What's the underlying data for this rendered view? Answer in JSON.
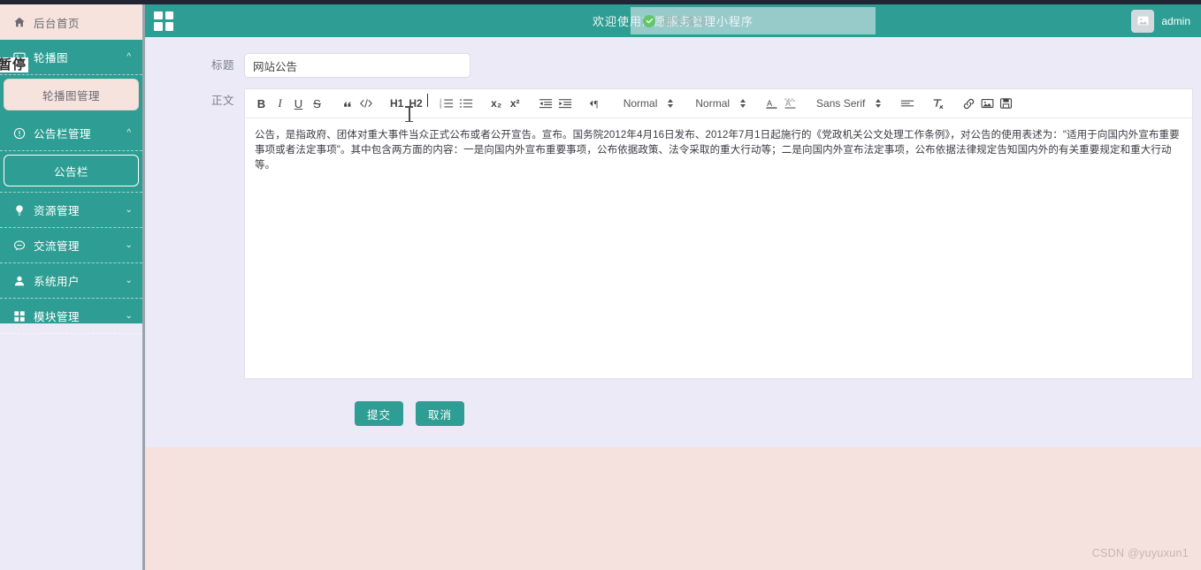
{
  "colors": {
    "brand": "#2e9e94",
    "sidebar_pink": "#f6e3de",
    "content_bg": "#ebeaf6",
    "content_bottom": "#f5e2de",
    "toast_green": "#63c66b",
    "top_strip": "#1f2533"
  },
  "header": {
    "menu_icon": "grid-menu-icon",
    "welcome_title": "欢迎使用志愿服务管理小程序",
    "toast": {
      "icon": "check-circle-icon",
      "message": "提交成功!"
    },
    "user": {
      "avatar_icon": "image-placeholder-icon",
      "name": "admin"
    }
  },
  "sidebar": {
    "home": {
      "icon": "home-icon",
      "label": "后台首页"
    },
    "groups": [
      {
        "icon": "image-icon",
        "label": "轮播图",
        "caret": "chevron-up-icon",
        "expanded": true,
        "children": [
          {
            "label": "轮播图管理",
            "active": false
          }
        ]
      },
      {
        "icon": "alert-circle-icon",
        "label": "公告栏管理",
        "caret": "chevron-up-icon",
        "expanded": true,
        "children": [
          {
            "label": "公告栏",
            "active": true
          }
        ]
      },
      {
        "icon": "bulb-icon",
        "label": "资源管理",
        "caret": "chevron-down-icon",
        "expanded": false,
        "children": []
      },
      {
        "icon": "chat-icon",
        "label": "交流管理",
        "caret": "chevron-down-icon",
        "expanded": false,
        "children": []
      },
      {
        "icon": "user-icon",
        "label": "系统用户",
        "caret": "chevron-down-icon",
        "expanded": false,
        "children": []
      },
      {
        "icon": "grid-icon",
        "label": "模块管理",
        "caret": "chevron-down-icon",
        "expanded": false,
        "children": []
      }
    ],
    "overlay_artifact": "暂停"
  },
  "form": {
    "title_field": {
      "label": "标题",
      "value": "网站公告",
      "placeholder": ""
    },
    "body_field": {
      "label": "正文"
    },
    "submit_label": "提交",
    "cancel_label": "取消"
  },
  "editor": {
    "toolbar": {
      "bold": "B",
      "italic": "I",
      "underline": "U",
      "strike": "S",
      "blockquote": "blockquote-icon",
      "code": "code-icon",
      "h1": "H1",
      "h2": "H2",
      "ordered_list": "ordered-list-icon",
      "bullet_list": "bullet-list-icon",
      "subscript": "x₂",
      "superscript": "x²",
      "outdent": "outdent-icon",
      "indent": "indent-icon",
      "direction": "text-direction-icon",
      "size_select": "Normal",
      "header_select": "Normal",
      "text_color": "text-color-icon",
      "background_color": "background-color-icon",
      "font_select": "Sans Serif",
      "align": "align-icon",
      "clear_format": "clear-format-icon",
      "link": "link-icon",
      "image": "image-icon",
      "video": "video-icon"
    },
    "content": "公告，是指政府、团体对重大事件当众正式公布或者公开宣告。宣布。国务院2012年4月16日发布、2012年7月1日起施行的《党政机关公文处理工作条例》，对公告的使用表述为：\"适用于向国内外宣布重要事项或者法定事项\"。其中包含两方面的内容：一是向国内外宣布重要事项，公布依据政策、法令采取的重大行动等；二是向国内外宣布法定事项，公布依据法律规定告知国内外的有关重要规定和重大行动等。"
  },
  "footer": {
    "watermark": "CSDN @yuyuxun1"
  }
}
